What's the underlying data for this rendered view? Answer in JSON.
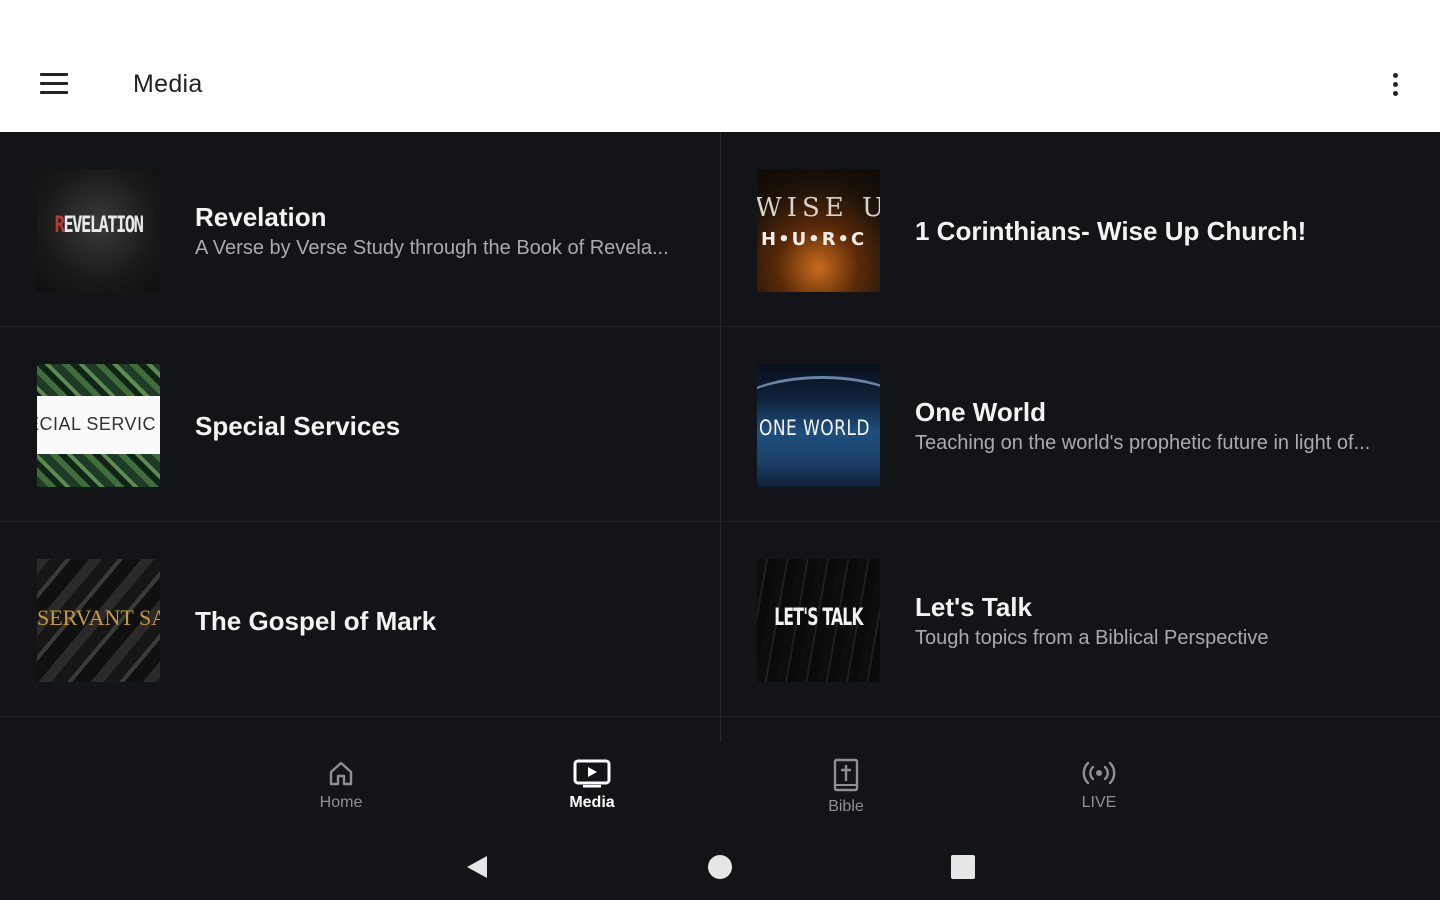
{
  "app_bar": {
    "title": "Media",
    "menu_icon": "hamburger-menu-icon",
    "overflow_icon": "more-vertical-icon"
  },
  "media": {
    "items": [
      {
        "title": "Revelation",
        "subtitle": "A Verse by Verse Study through the Book of Revela...",
        "thumb_text": "REVELATION",
        "thumb_text_initial": "R"
      },
      {
        "title": "1 Corinthians- Wise Up Church!",
        "subtitle": "",
        "thumb_text": "WISE UP",
        "thumb_text2": "H•U•R•C"
      },
      {
        "title": "Special Services",
        "subtitle": "",
        "thumb_text": "ECIAL SERVIC"
      },
      {
        "title": "One World",
        "subtitle": "Teaching on the world's prophetic future in light of...",
        "thumb_text": "ONE WORLD"
      },
      {
        "title": "The Gospel of Mark",
        "subtitle": "",
        "thumb_text": "SERVANT SA"
      },
      {
        "title": "Let's Talk",
        "subtitle": "Tough topics from a Biblical Perspective",
        "thumb_text": "LET'S TALK"
      }
    ]
  },
  "bottom_nav": {
    "items": [
      {
        "label": "Home",
        "icon": "home-icon",
        "active": false
      },
      {
        "label": "Media",
        "icon": "media-play-icon",
        "active": true
      },
      {
        "label": "Bible",
        "icon": "bible-icon",
        "active": false
      },
      {
        "label": "LIVE",
        "icon": "live-broadcast-icon",
        "active": false
      }
    ]
  },
  "system_nav": {
    "back_icon": "back-triangle-icon",
    "home_icon": "home-circle-icon",
    "recents_icon": "recents-square-icon"
  },
  "colors": {
    "background": "#131417",
    "app_bar": "#ffffff",
    "title_text": "#f3f3f3",
    "subtitle_text": "#a9abaf",
    "nav_inactive": "#8e9094",
    "nav_active": "#ffffff"
  }
}
